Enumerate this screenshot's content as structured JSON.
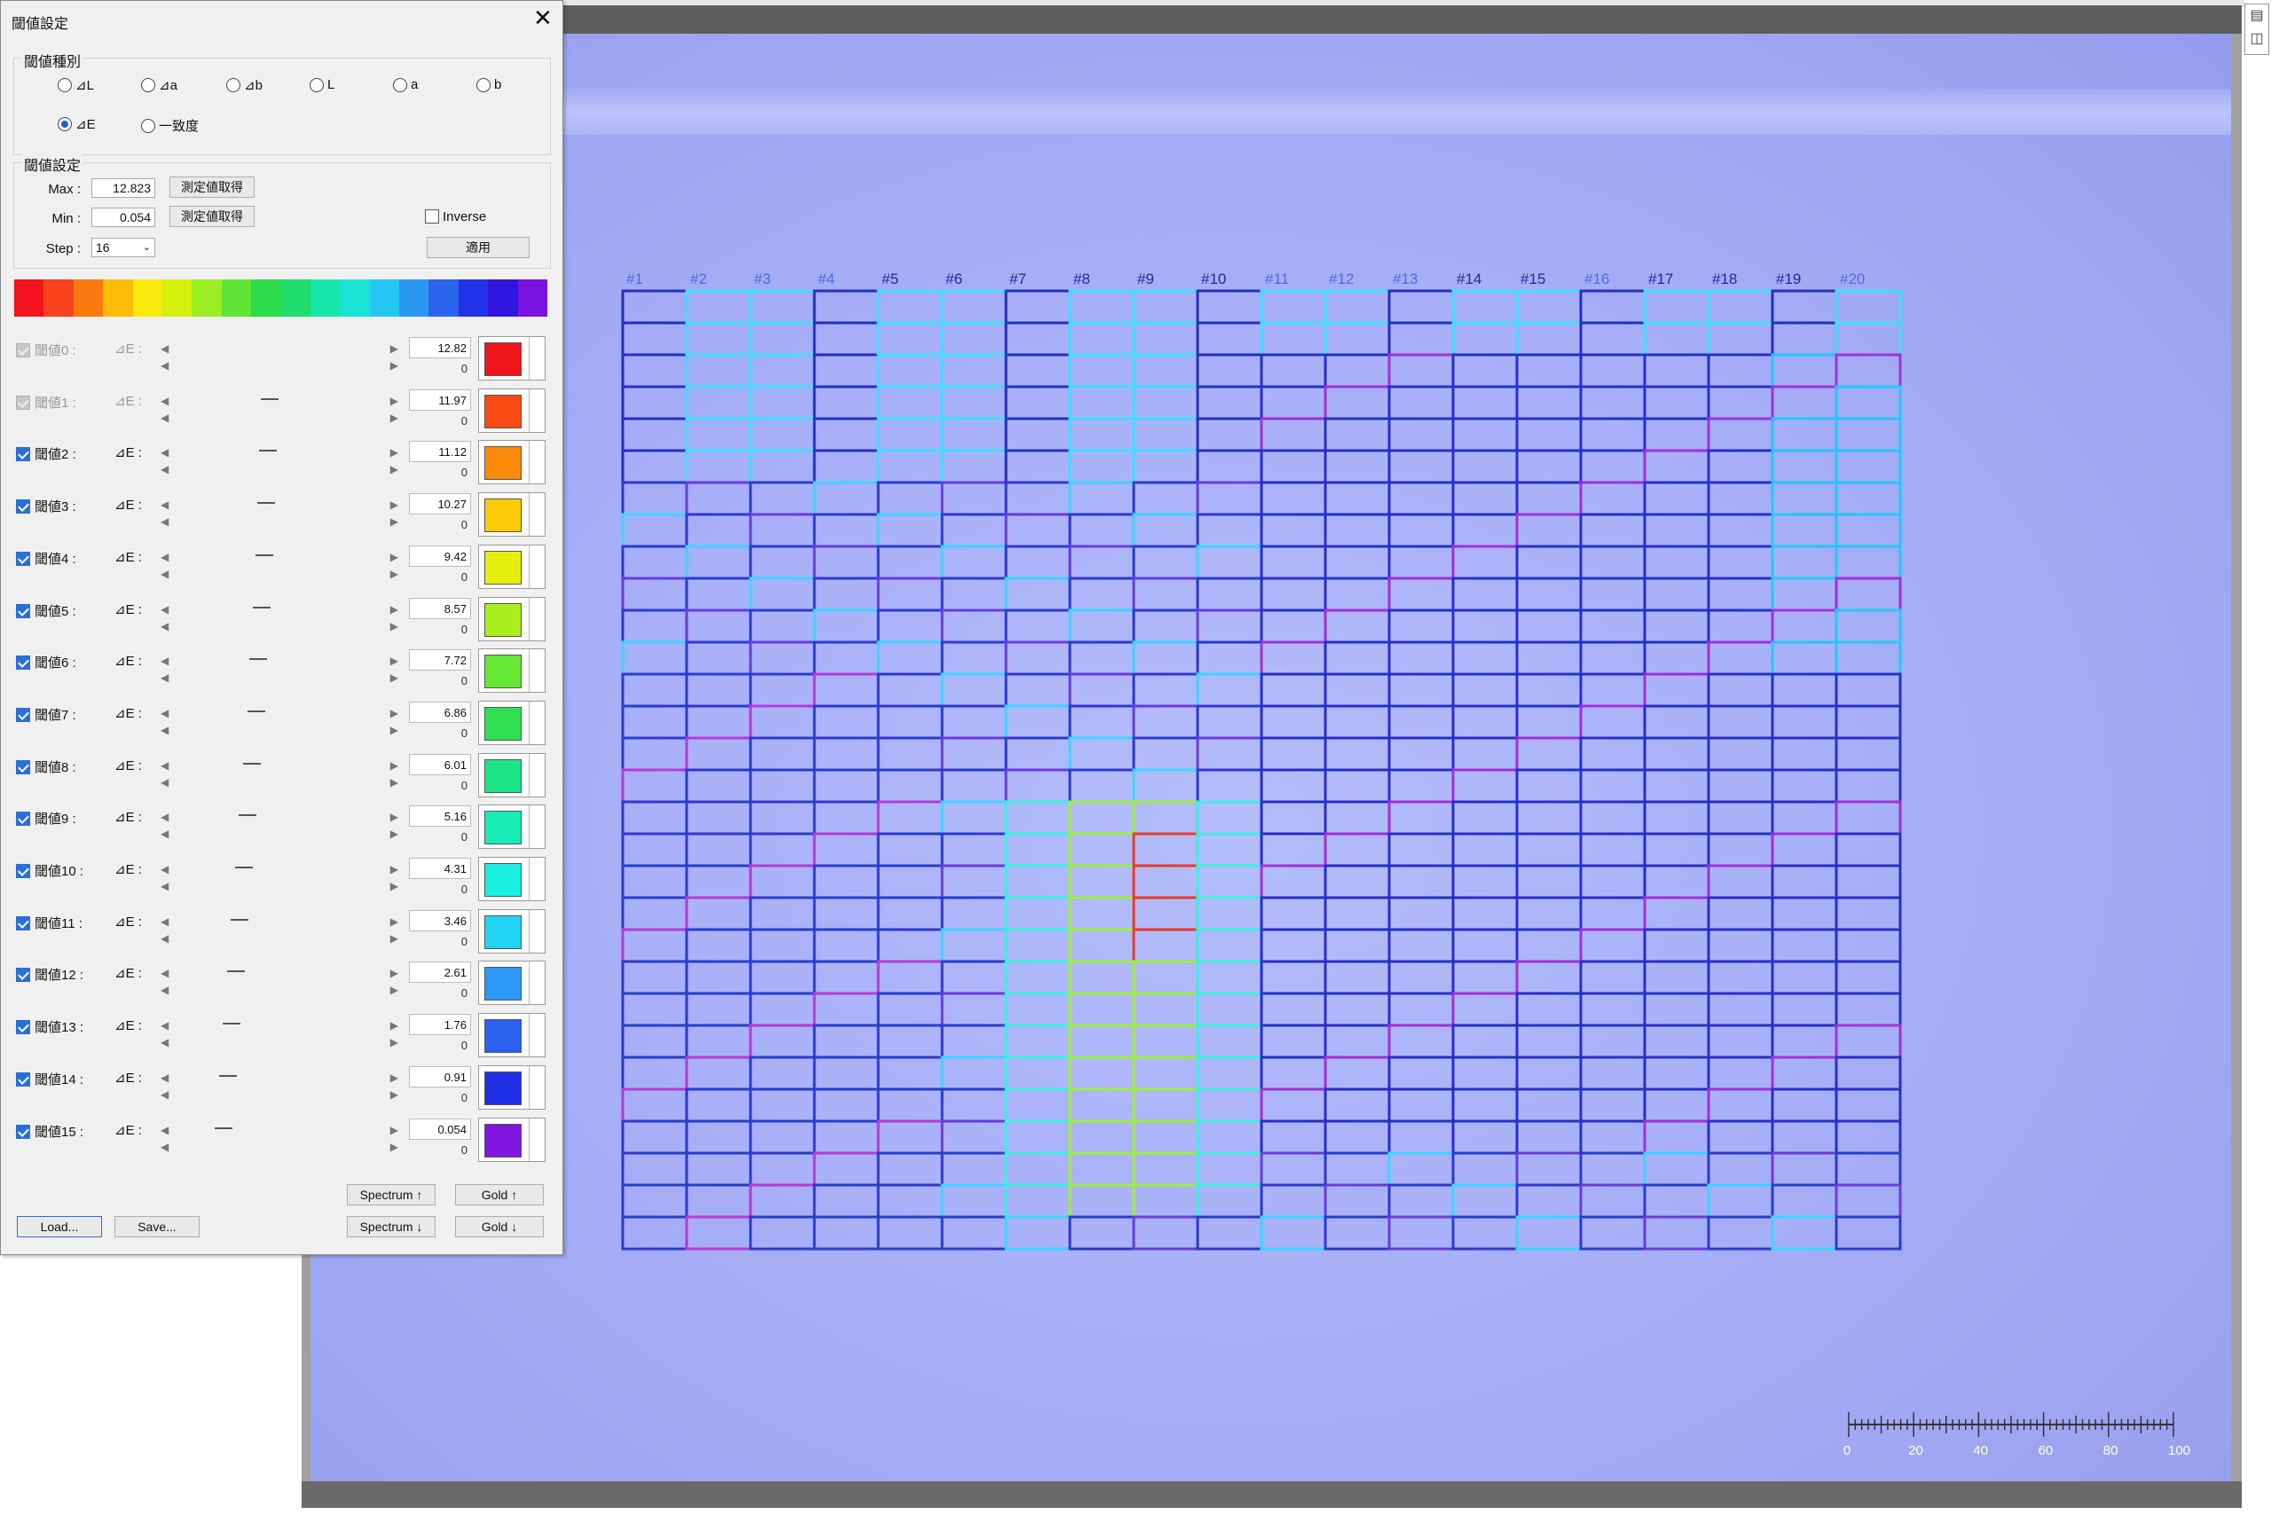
{
  "dialog": {
    "title": "閾値設定",
    "close_label": "✕",
    "threshold_type": {
      "group_label": "閾値種別",
      "options": [
        {
          "label": "⊿L",
          "selected": false
        },
        {
          "label": "⊿a",
          "selected": false
        },
        {
          "label": "⊿b",
          "selected": false
        },
        {
          "label": "L",
          "selected": false
        },
        {
          "label": "a",
          "selected": false
        },
        {
          "label": "b",
          "selected": false
        },
        {
          "label": "⊿E",
          "selected": true
        },
        {
          "label": "一致度",
          "selected": false
        }
      ]
    },
    "threshold_settings": {
      "group_label": "閾値設定",
      "max_label": "Max :",
      "max_value": "12.823",
      "min_label": "Min :",
      "min_value": "0.054",
      "fetch_button": "測定値取得",
      "inverse_label": "Inverse",
      "inverse_checked": false,
      "step_label": "Step :",
      "step_value": "16",
      "apply_button": "適用"
    },
    "spectrum_colors": [
      "#f2131d",
      "#f7421d",
      "#fb7a0f",
      "#fbbd06",
      "#f9e90b",
      "#d2f10d",
      "#9bee22",
      "#5fe537",
      "#2cdc4b",
      "#1edd6e",
      "#16e6a8",
      "#18e4d6",
      "#25c8f2",
      "#2a98f3",
      "#2a63ec",
      "#2133e8",
      "#2f15dd",
      "#7913e2"
    ],
    "rows": [
      {
        "name": "閾値0 :",
        "metric": "⊿E :",
        "value": "12.82",
        "min": "0",
        "color": "#f0141c",
        "checked": true,
        "enabled": false,
        "level": 0.0
      },
      {
        "name": "閾値1 :",
        "metric": "⊿E :",
        "value": "11.97",
        "min": "0",
        "color": "#f94a14",
        "checked": true,
        "enabled": false,
        "level": 0.41
      },
      {
        "name": "閾値2 :",
        "metric": "⊿E :",
        "value": "11.12",
        "min": "0",
        "color": "#fb8a0c",
        "checked": true,
        "enabled": true,
        "level": 0.4
      },
      {
        "name": "閾値3 :",
        "metric": "⊿E :",
        "value": "10.27",
        "min": "0",
        "color": "#fcca07",
        "checked": true,
        "enabled": true,
        "level": 0.39
      },
      {
        "name": "閾値4 :",
        "metric": "⊿E :",
        "value": "9.42",
        "min": "0",
        "color": "#e5ef0f",
        "checked": true,
        "enabled": true,
        "level": 0.38
      },
      {
        "name": "閾値5 :",
        "metric": "⊿E :",
        "value": "8.57",
        "min": "0",
        "color": "#a8ef1d",
        "checked": true,
        "enabled": true,
        "level": 0.37
      },
      {
        "name": "閾値6 :",
        "metric": "⊿E :",
        "value": "7.72",
        "min": "0",
        "color": "#66e834",
        "checked": true,
        "enabled": true,
        "level": 0.35
      },
      {
        "name": "閾値7 :",
        "metric": "⊿E :",
        "value": "6.86",
        "min": "0",
        "color": "#2fe053",
        "checked": true,
        "enabled": true,
        "level": 0.34
      },
      {
        "name": "閾値8 :",
        "metric": "⊿E :",
        "value": "6.01",
        "min": "0",
        "color": "#1de587",
        "checked": true,
        "enabled": true,
        "level": 0.32
      },
      {
        "name": "閾値9 :",
        "metric": "⊿E :",
        "value": "5.16",
        "min": "0",
        "color": "#17ecb5",
        "checked": true,
        "enabled": true,
        "level": 0.3
      },
      {
        "name": "閾値10 :",
        "metric": "⊿E :",
        "value": "4.31",
        "min": "0",
        "color": "#1af0e2",
        "checked": true,
        "enabled": true,
        "level": 0.28
      },
      {
        "name": "閾値11 :",
        "metric": "⊿E :",
        "value": "3.46",
        "min": "0",
        "color": "#22d4f6",
        "checked": true,
        "enabled": true,
        "level": 0.26
      },
      {
        "name": "閾値12 :",
        "metric": "⊿E :",
        "value": "2.61",
        "min": "0",
        "color": "#2a98f4",
        "checked": true,
        "enabled": true,
        "level": 0.24
      },
      {
        "name": "閾値13 :",
        "metric": "⊿E :",
        "value": "1.76",
        "min": "0",
        "color": "#2a62ee",
        "checked": true,
        "enabled": true,
        "level": 0.22
      },
      {
        "name": "閾値14 :",
        "metric": "⊿E :",
        "value": "0.91",
        "min": "0",
        "color": "#1f2fe6",
        "checked": true,
        "enabled": true,
        "level": 0.2
      },
      {
        "name": "閾値15 :",
        "metric": "⊿E :",
        "value": "0.054",
        "min": "0",
        "color": "#7e16e0",
        "checked": true,
        "enabled": true,
        "level": 0.18
      }
    ],
    "buttons": {
      "load": "Load...",
      "save": "Save...",
      "spectrum_up": "Spectrum ↑",
      "spectrum_down": "Spectrum ↓",
      "gold_up": "Gold ↑",
      "gold_down": "Gold ↓"
    }
  },
  "image_view": {
    "grid": {
      "columns": 20,
      "rows": 30,
      "column_labels": [
        "#1",
        "#2",
        "#3",
        "#4",
        "#5",
        "#6",
        "#7",
        "#8",
        "#9",
        "#10",
        "#11",
        "#12",
        "#13",
        "#14",
        "#15",
        "#16",
        "#17",
        "#18",
        "#19",
        "#20"
      ]
    },
    "scale_bar": {
      "ticks": [
        "0",
        "20",
        "40",
        "60",
        "80",
        "100"
      ]
    }
  }
}
